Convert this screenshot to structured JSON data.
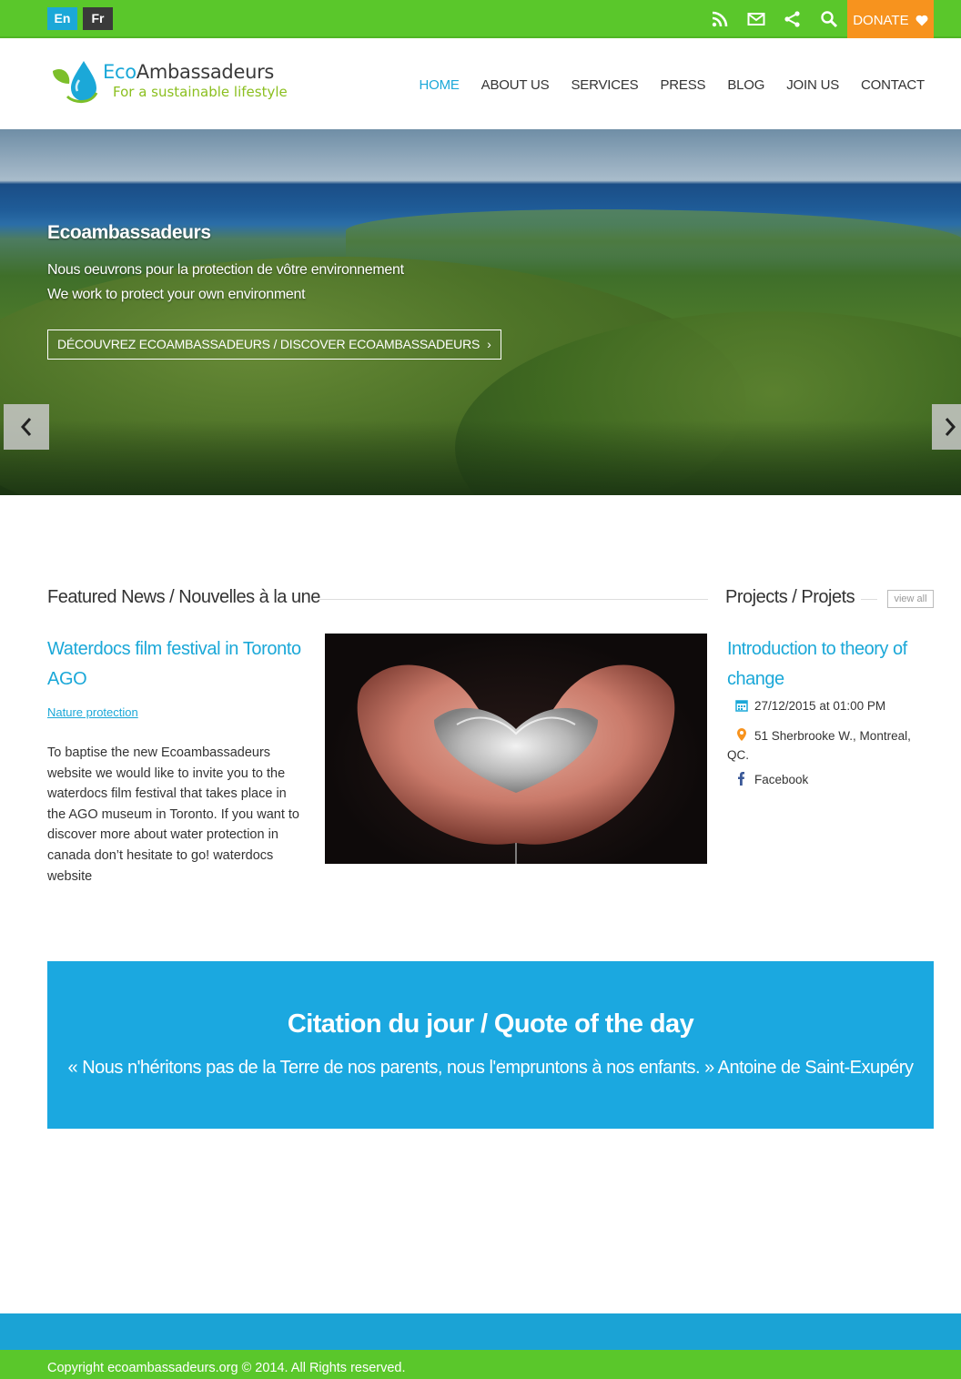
{
  "topbar": {
    "lang_en": "En",
    "lang_fr": "Fr",
    "icons": [
      "rss-icon",
      "mail-icon",
      "share-icon",
      "search-icon"
    ],
    "donate_label": "DONATE",
    "accent": "#5ac72b",
    "donate_color": "#f7931e"
  },
  "header": {
    "logo_eco": "Eco",
    "logo_ambassadeurs": "Ambassadeurs",
    "logo_tagline": "For a sustainable lifestyle",
    "nav": [
      "HOME",
      "ABOUT US",
      "SERVICES",
      "PRESS",
      "BLOG",
      "JOIN US",
      "CONTACT"
    ],
    "active_nav": "HOME"
  },
  "hero": {
    "title": "Ecoambassadeurs",
    "line1": "Nous oeuvrons pour la protection de vôtre environnement",
    "line2": "We work to protect your own environment",
    "button_label": "DÉCOUVREZ ECOAMBASSADEURS / DISCOVER ECOAMBASSADEURS"
  },
  "featured": {
    "heading": "Featured News / Nouvelles à la une",
    "news_title": "Waterdocs film festival in Toronto AGO",
    "news_category": "Nature protection",
    "news_body": "To baptise the new Ecoambassadeurs website we would like to invite you to the waterdocs film festival that takes place in the AGO museum in Toronto. If you want to discover more about water protection in canada don’t hesitate to go! waterdocs website"
  },
  "projects": {
    "heading": "Projects / Projets",
    "view_all": "view all",
    "title": "Introduction to theory of change",
    "date": "27/12/2015 at 01:00 PM",
    "address_line1": "51 Sherbrooke W., Montreal,",
    "address_line2": "QC.",
    "facebook": "Facebook"
  },
  "quote": {
    "title": "Citation du jour / Quote of the day",
    "text": "« Nous n'héritons pas de la Terre de nos parents, nous l'empruntons à nos enfants. » Antoine de Saint-Exupéry",
    "background": "#1ba8e0"
  },
  "footer": {
    "copyright": "Copyright ecoambassadeurs.org © 2014. All Rights reserved."
  }
}
